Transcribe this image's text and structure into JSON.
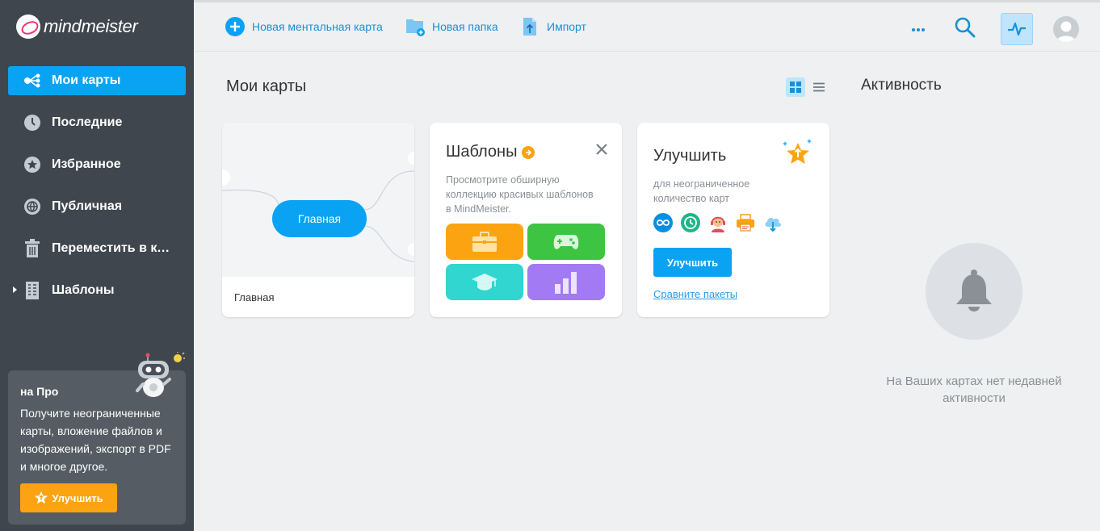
{
  "app": {
    "logo_text": "mindmeister"
  },
  "sidebar": {
    "items": [
      {
        "label": "Мои карты",
        "icon": "mindmap-icon",
        "active": true
      },
      {
        "label": "Последние",
        "icon": "clock-icon"
      },
      {
        "label": "Избранное",
        "icon": "star-icon"
      },
      {
        "label": "Публичная",
        "icon": "globe-icon"
      },
      {
        "label": "Переместить в корзину",
        "icon": "trash-icon"
      },
      {
        "label": "Шаблоны",
        "icon": "templates-icon"
      }
    ],
    "promo": {
      "title": "на Про",
      "text": "Получите неограниченные карты, вложение файлов и изображений, экспорт в PDF и многое другое.",
      "button_label": "Улучшить"
    }
  },
  "toolbar": {
    "new_map_label": "Новая ментальная карта",
    "new_folder_label": "Новая папка",
    "import_label": "Импорт"
  },
  "main": {
    "title": "Мои карты",
    "map_card": {
      "node_label": "Главная",
      "caption": "Главная"
    },
    "templates_card": {
      "title": "Шаблоны",
      "description": "Просмотрите обширную коллекцию красивых шаблонов в MindMeister."
    },
    "upgrade_card": {
      "title": "Улучшить",
      "description": "для неограниченное количество карт",
      "button_label": "Улучшить",
      "link_label": "Сравните пакеты"
    }
  },
  "activity": {
    "title": "Активность",
    "empty_text": "На Ваших картах нет недавней активности"
  },
  "colors": {
    "accent": "#0aa3f3",
    "sidebar_bg": "#3f464e",
    "promo_button": "#fca311",
    "tile_orange": "#fca311",
    "tile_green": "#3dc443",
    "tile_teal": "#30d6cf",
    "tile_purple": "#a27af3"
  }
}
